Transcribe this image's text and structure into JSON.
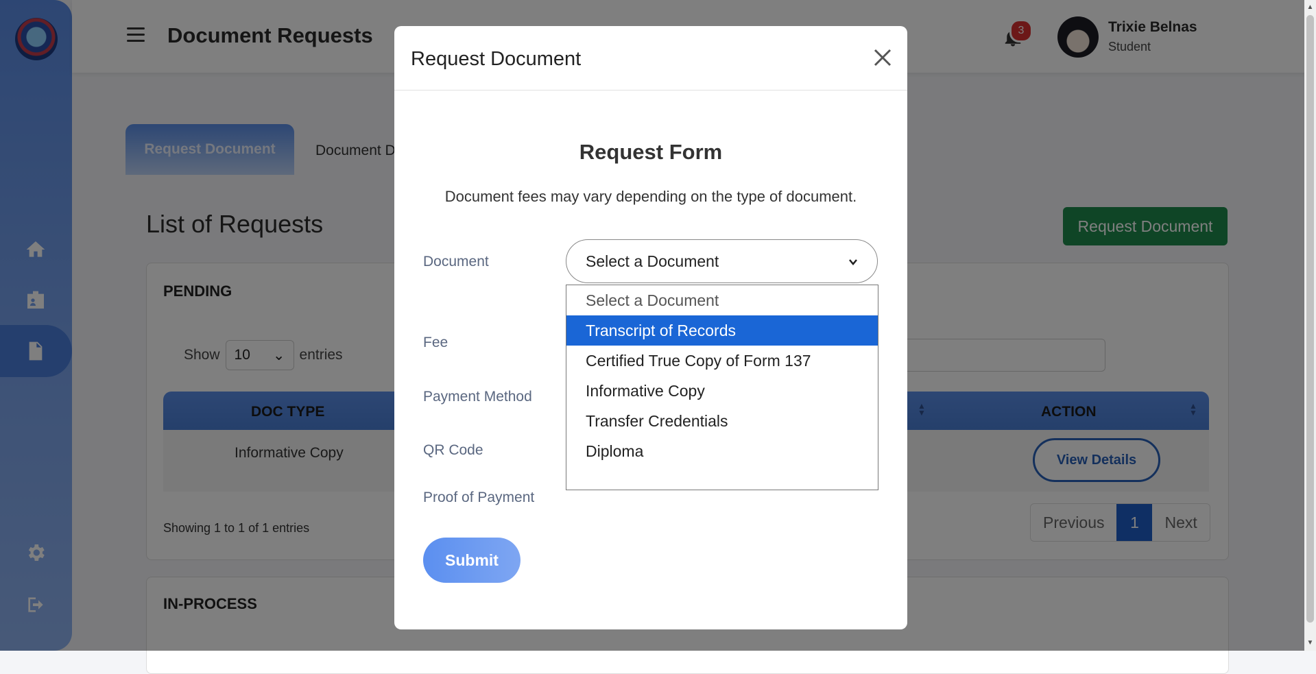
{
  "header": {
    "page_title": "Document Requests",
    "notification_count": "3",
    "user_name": "Trixie Belnas",
    "user_role": "Student"
  },
  "tabs": [
    {
      "label": "Request Document",
      "active": true
    },
    {
      "label": "Document D"
    }
  ],
  "list": {
    "title": "List of Requests",
    "request_button": "Request Document",
    "pending": {
      "heading": "PENDING",
      "show_label": "Show",
      "entries_value": "10",
      "entries_label": "entries",
      "columns": [
        "DOC TYPE",
        "ACTION"
      ],
      "rows": [
        {
          "doc_type": "Informative Copy",
          "action": "View Details"
        }
      ],
      "showing_text": "Showing 1 to 1 of 1 entries",
      "pager": {
        "previous": "Previous",
        "page": "1",
        "next": "Next"
      }
    },
    "inprocess": {
      "heading": "IN-PROCESS"
    }
  },
  "modal": {
    "title": "Request Document",
    "form_title": "Request Form",
    "note": "Document fees may vary depending on the type of document.",
    "labels": {
      "document": "Document",
      "fee": "Fee",
      "payment_method": "Payment Method",
      "qr_code": "QR Code",
      "proof_of_payment": "Proof of Payment"
    },
    "document_select_value": "Select a Document",
    "document_options": [
      "Select a Document",
      "Transcript of Records",
      "Certified True Copy of Form 137",
      "Informative Copy",
      "Transfer Credentials",
      "Diploma"
    ],
    "highlighted_option": "Transcript of Records",
    "submit": "Submit"
  },
  "icons": {
    "sidebar": [
      "home-icon",
      "id-card-icon",
      "document-icon",
      "gear-icon",
      "logout-icon"
    ],
    "header": [
      "hamburger-icon",
      "bell-icon",
      "close-icon",
      "chevron-down-icon"
    ]
  },
  "colors": {
    "sidebar": "#5b8de6",
    "primary": "#1f5ec8",
    "success": "#1f8b4c",
    "badge": "#d93030",
    "highlight": "#1a66d6"
  }
}
